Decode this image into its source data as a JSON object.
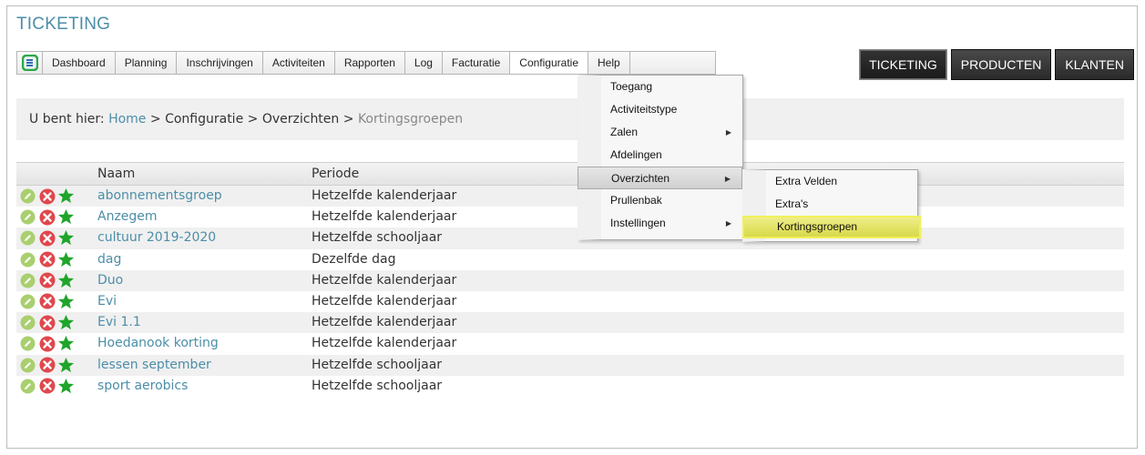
{
  "app": {
    "title": "TICKETING"
  },
  "menubar": {
    "items": [
      "Dashboard",
      "Planning",
      "Inschrijvingen",
      "Activiteiten",
      "Rapporten",
      "Log",
      "Facturatie",
      "Configuratie",
      "Help"
    ]
  },
  "top_buttons": [
    "TICKETING",
    "PRODUCTEN",
    "KLANTEN"
  ],
  "breadcrumb": {
    "prefix": "U bent hier:",
    "home": "Home",
    "sep": ">",
    "configuratie": "Configuratie",
    "overzichten": "Overzichten",
    "current": "Kortingsgroepen"
  },
  "dropdown": {
    "items": [
      {
        "label": "Toegang",
        "arrow": ""
      },
      {
        "label": "Activiteitstype",
        "arrow": ""
      },
      {
        "label": "Zalen",
        "arrow": "▶"
      },
      {
        "label": "Afdelingen",
        "arrow": ""
      },
      {
        "label": "Overzichten",
        "arrow": "▶"
      },
      {
        "label": "Prullenbak",
        "arrow": ""
      },
      {
        "label": "Instellingen",
        "arrow": "▶"
      }
    ]
  },
  "submenu": {
    "items": [
      "Extra Velden",
      "Extra's",
      "Kortingsgroepen"
    ]
  },
  "table": {
    "headers": {
      "name": "Naam",
      "period": "Periode"
    },
    "rows": [
      {
        "name": "abonnementsgroep",
        "period": "Hetzelfde kalenderjaar"
      },
      {
        "name": "Anzegem",
        "period": "Hetzelfde kalenderjaar"
      },
      {
        "name": "cultuur 2019-2020",
        "period": "Hetzelfde schooljaar"
      },
      {
        "name": "dag",
        "period": "Dezelfde dag"
      },
      {
        "name": "Duo",
        "period": "Hetzelfde kalenderjaar"
      },
      {
        "name": "Evi",
        "period": "Hetzelfde kalenderjaar"
      },
      {
        "name": "Evi 1.1",
        "period": "Hetzelfde kalenderjaar"
      },
      {
        "name": "Hoedanook korting",
        "period": "Hetzelfde kalenderjaar"
      },
      {
        "name": "lessen september",
        "period": "Hetzelfde schooljaar"
      },
      {
        "name": "sport aerobics",
        "period": "Hetzelfde schooljaar"
      }
    ]
  },
  "colors": {
    "accent": "#4c8ea8",
    "edit": "#a9cf6f",
    "delete": "#e0474c",
    "star": "#1fa52a",
    "highlight": "#e3e35a"
  },
  "icons": {
    "edit": "pencil-icon",
    "delete": "delete-icon",
    "favorite": "star-icon",
    "logo": "logo-icon"
  }
}
